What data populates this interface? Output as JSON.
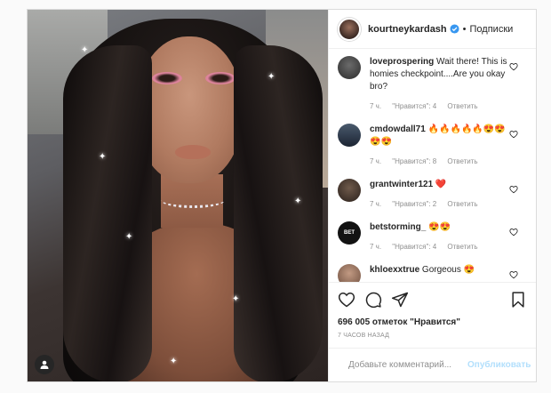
{
  "header": {
    "username": "kourtneykardash",
    "verified_icon": "verified-badge-icon",
    "separator": "•",
    "follow_label": "Подписки"
  },
  "comments": [
    {
      "username": "loveprospering",
      "text": "Wait there! This is homies checkpoint....Are you okay bro?",
      "time": "7 ч.",
      "likes": "\"Нравится\": 4",
      "reply": "Ответить"
    },
    {
      "username": "cmdowdall71",
      "text": "🔥🔥🔥🔥🔥😍😍😍😍",
      "time": "7 ч.",
      "likes": "\"Нравится\": 8",
      "reply": "Ответить"
    },
    {
      "username": "grantwinter121",
      "text": "❤️",
      "time": "7 ч.",
      "likes": "\"Нравится\": 2",
      "reply": "Ответить"
    },
    {
      "username": "betstorming_",
      "text": "😍😍",
      "time": "7 ч.",
      "likes": "\"Нравится\": 4",
      "reply": "Ответить"
    },
    {
      "username": "khloexxtrue",
      "text": "Gorgeous 😍"
    }
  ],
  "avatar_labels": {
    "betstorming": "BET"
  },
  "post_actions": {
    "like": "heart-icon",
    "comment": "comment-icon",
    "share": "share-icon",
    "save": "bookmark-icon"
  },
  "likes_text": "696 005 отметок \"Нравится\"",
  "time_ago": "7 часов назад",
  "add_comment": {
    "placeholder": "Добавьте комментарий...",
    "publish_label": "Опубликовать"
  },
  "colors": {
    "border": "#dbdbdb",
    "text": "#262626",
    "muted": "#8e8e8e",
    "publish_disabled": "#b2dffc",
    "verified": "#3897f0",
    "heart": "#ed4956"
  }
}
